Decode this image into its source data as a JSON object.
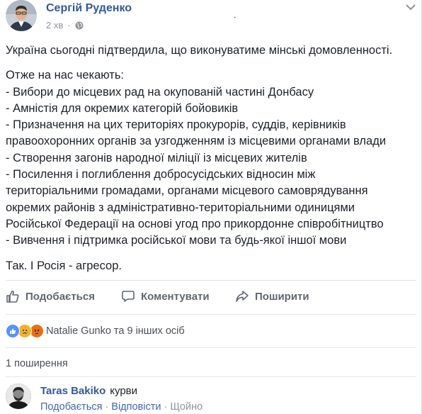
{
  "post": {
    "author": "Сергій Руденко",
    "time": "2 хв",
    "privacy_icon": "globe-icon",
    "paragraph1": "Україна сьогодні підтвердила, що виконуватиме мінські домовленності.",
    "intro": "Отже на нас чекають:",
    "lines": [
      "- Вибори до місцевих рад на окупованій частині Донбасу",
      "- Амністія для окремих категорій бойовиків",
      "- Призначення на цих територіях прокурорів, суддів, керівників",
      "правоохоронних органів за узгодженням із місцевими органами влади",
      "- Створення загонів народної міліції із місцевих жителів",
      "- Посилення і поглиблення добросусідських відносин між",
      "територіальними громадами, органами місцевого самоврядування",
      "окремих районів з адміністративно-територіальними одиницями",
      "Російської Федерації на основі угод про прикордонне співробітництво",
      "- Вивчення і підтримка російської мови та будь-якої іншої мови"
    ],
    "closing": "Так. І Росія - агресор.",
    "dot": "."
  },
  "actions": {
    "like": "Подобається",
    "comment": "Коментувати",
    "share": "Поширити"
  },
  "reactions": {
    "text": "Natalie Gunko та 9 інших осіб",
    "types": [
      "like",
      "sad",
      "angry"
    ],
    "colors": {
      "like": "#5890ff",
      "sad": "#f7b125",
      "angry": "#e9710f"
    }
  },
  "shares": "1 поширення",
  "comment": {
    "author": "Taras Bakiko",
    "text": "курви",
    "like": "Подобається",
    "reply": "Відповісти",
    "time": "Щойно",
    "separator": "·"
  }
}
